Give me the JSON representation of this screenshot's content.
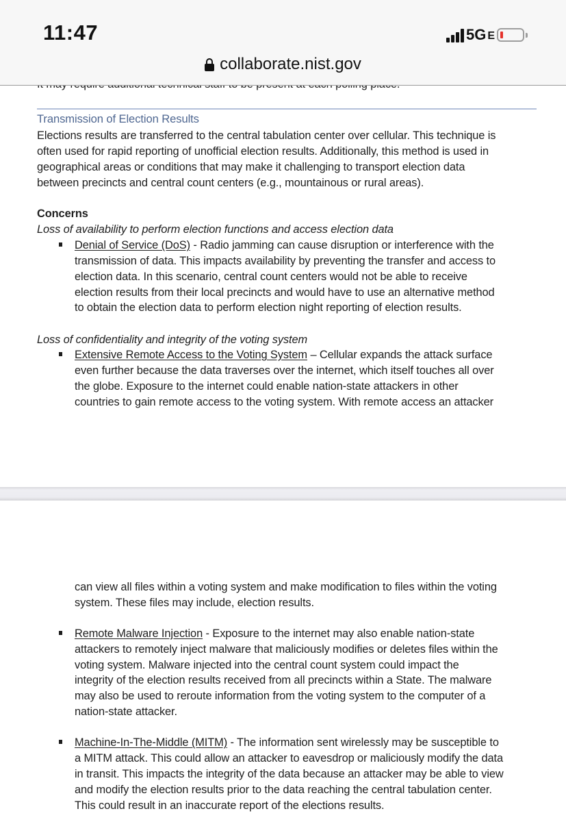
{
  "status_bar": {
    "time": "11:47",
    "network": "5G",
    "network_suffix": "E",
    "signal_bars": 4,
    "battery_level_percent": 8,
    "battery_color": "#e5322b"
  },
  "browser": {
    "url": "collaborate.nist.gov",
    "lock_icon": "lock-icon"
  },
  "document": {
    "clipped_line": "It may require additional technical staff to be present at each polling place.",
    "section_heading": "Transmission of Election Results",
    "section_heading_color": "#4f6791",
    "intro_lines": [
      "Elections results are transferred to the central tabulation center over cellular.  This technique is",
      "often used for rapid reporting of unofficial election results. Additionally, this method is used in",
      "geographical areas or conditions that may make it challenging to transport election data",
      "between precincts and central count centers (e.g., mountainous or rural areas)."
    ],
    "concerns_title": "Concerns",
    "groups": [
      {
        "subheading": "Loss of availability to perform election functions and access election data",
        "bullets": [
          {
            "term": "Denial of Service (DoS)",
            "first_line_rest": " - Radio jamming can cause disruption or interference with the",
            "lines": [
              "transmission of data.  This impacts availability by preventing the transfer and access to",
              "election data. In this scenario, central count centers would not be able to receive",
              "election results from their local precincts and would have to use an alternative method",
              "to obtain the election data to perform election night reporting of election results."
            ]
          }
        ]
      },
      {
        "subheading": "Loss of confidentiality and integrity of the voting system",
        "bullets": [
          {
            "term": "Extensive Remote Access to the Voting System",
            "first_line_rest": " – Cellular expands the attack surface",
            "lines": [
              "even further because the data traverses over the internet, which itself touches all over",
              "the globe. Exposure to the internet could enable nation-state attackers in other",
              "countries to gain remote access to the voting system.  With remote access an attacker"
            ],
            "continued_lines": [
              "can view all files within a voting system and make modification to files within the voting",
              "system.  These files may include, election results."
            ]
          },
          {
            "term": "Remote Malware Injection",
            "first_line_rest": " - Exposure to the internet may also enable nation-state",
            "lines": [
              "attackers to remotely inject malware that maliciously modifies or deletes files within the",
              "voting system. Malware injected into the central count system could impact the",
              "integrity of the election results received from all precincts within a State. The malware",
              "may also be used to reroute information from the voting system to the computer of a",
              "nation-state attacker."
            ]
          },
          {
            "term": "Machine-In-The-Middle (MITM)",
            "first_line_rest": " - The information sent wirelessly may be susceptible to",
            "lines": [
              "a MITM attack.  This could allow an attacker to eavesdrop or maliciously modify the data",
              "in transit. This impacts the integrity of the data because an attacker may be able to view",
              "and modify the election results prior to the data reaching the central tabulation center.",
              "This could result in an inaccurate report of the elections results."
            ]
          }
        ]
      }
    ]
  }
}
